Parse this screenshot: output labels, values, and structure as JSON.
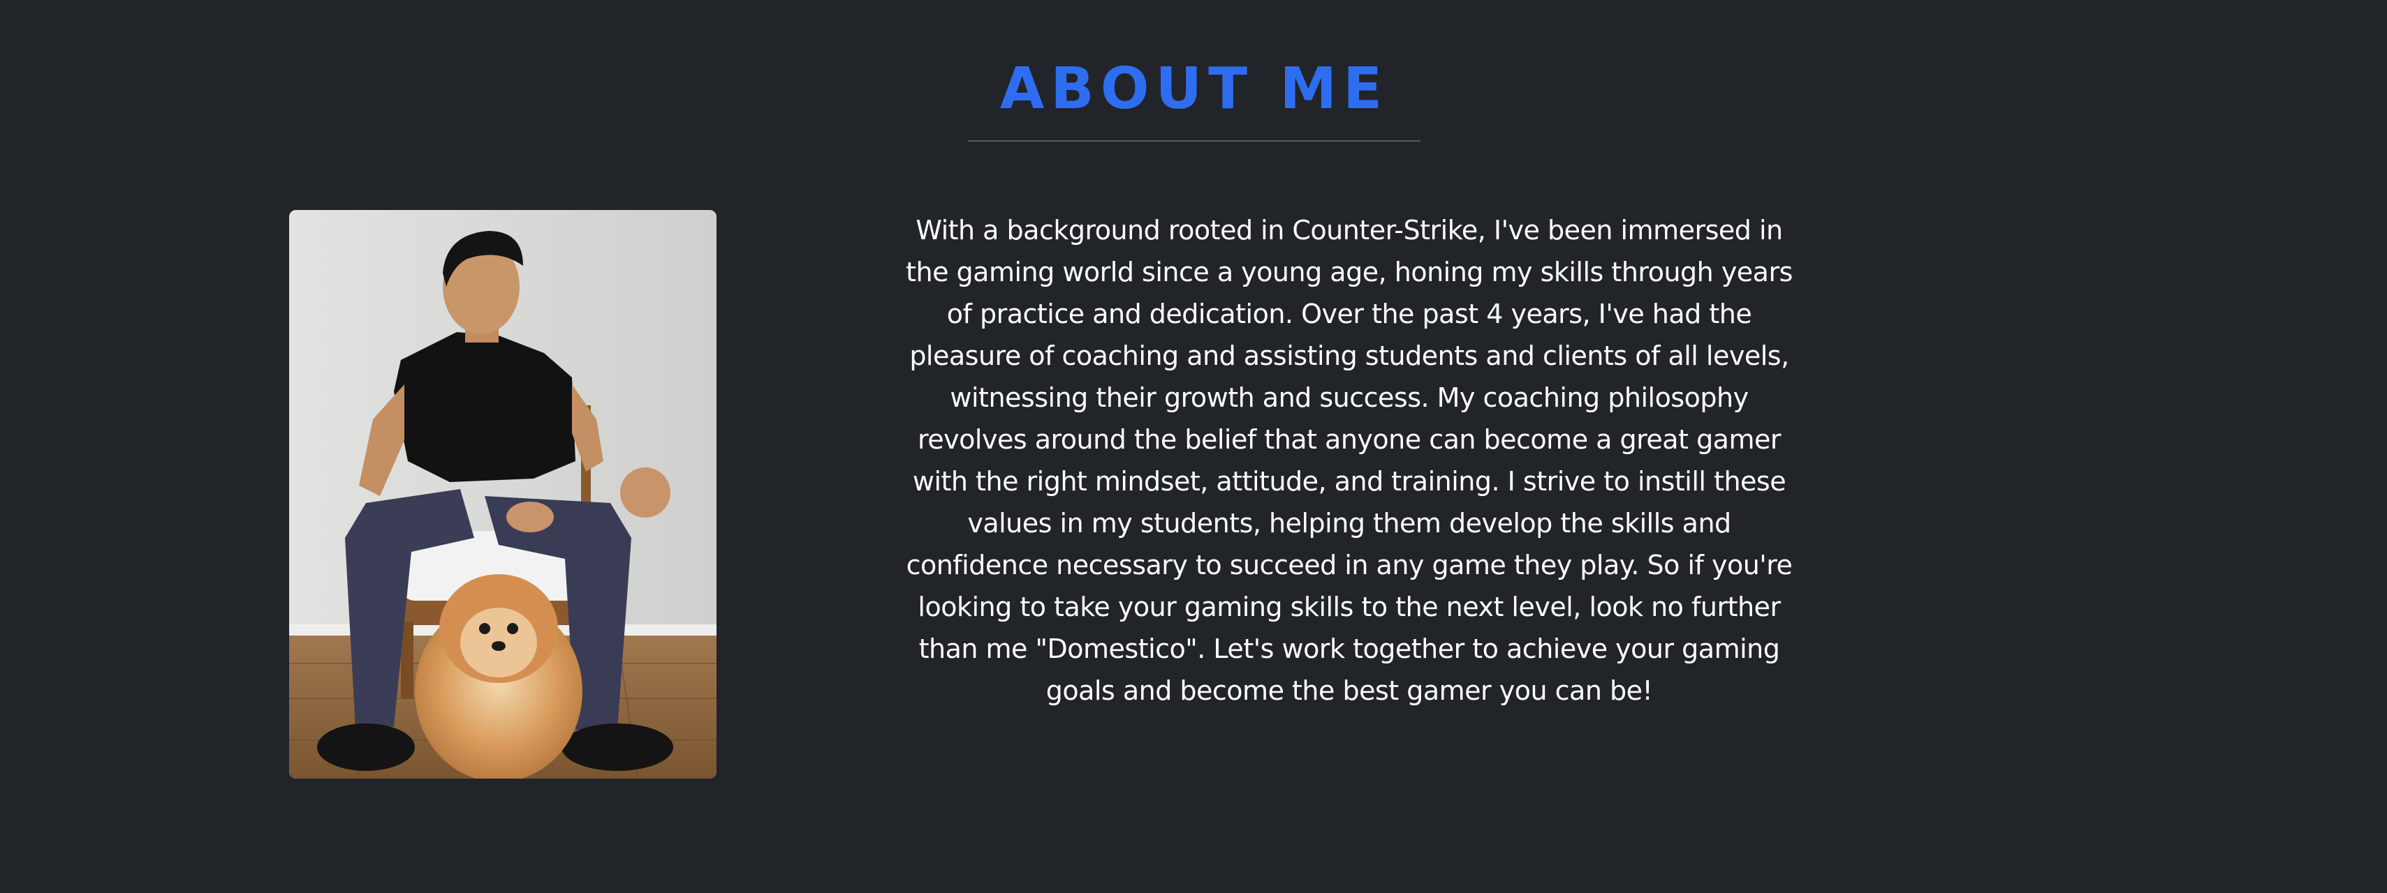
{
  "about": {
    "title": "ABOUT ME",
    "bio": "With a background rooted in Counter-Strike, I've been immersed in the gaming world since a young age, honing my skills through years of practice and dedication. Over the past 4 years, I've had the pleasure of coaching and assisting students and clients of all levels, witnessing their growth and success. My coaching philosophy revolves around the belief that anyone can become a great gamer with the right mindset, attitude, and training. I strive to instill these values in my students, helping them develop the skills and confidence necessary to succeed in any game they play. So if you're looking to take your gaming skills to the next level, look no further than me \"Domestico\". Let's work together to achieve your gaming goals and become the best gamer you can be!"
  },
  "colors": {
    "background": "#212429",
    "accent": "#2f6df0",
    "text": "#ffffff",
    "divider": "#555a61"
  }
}
